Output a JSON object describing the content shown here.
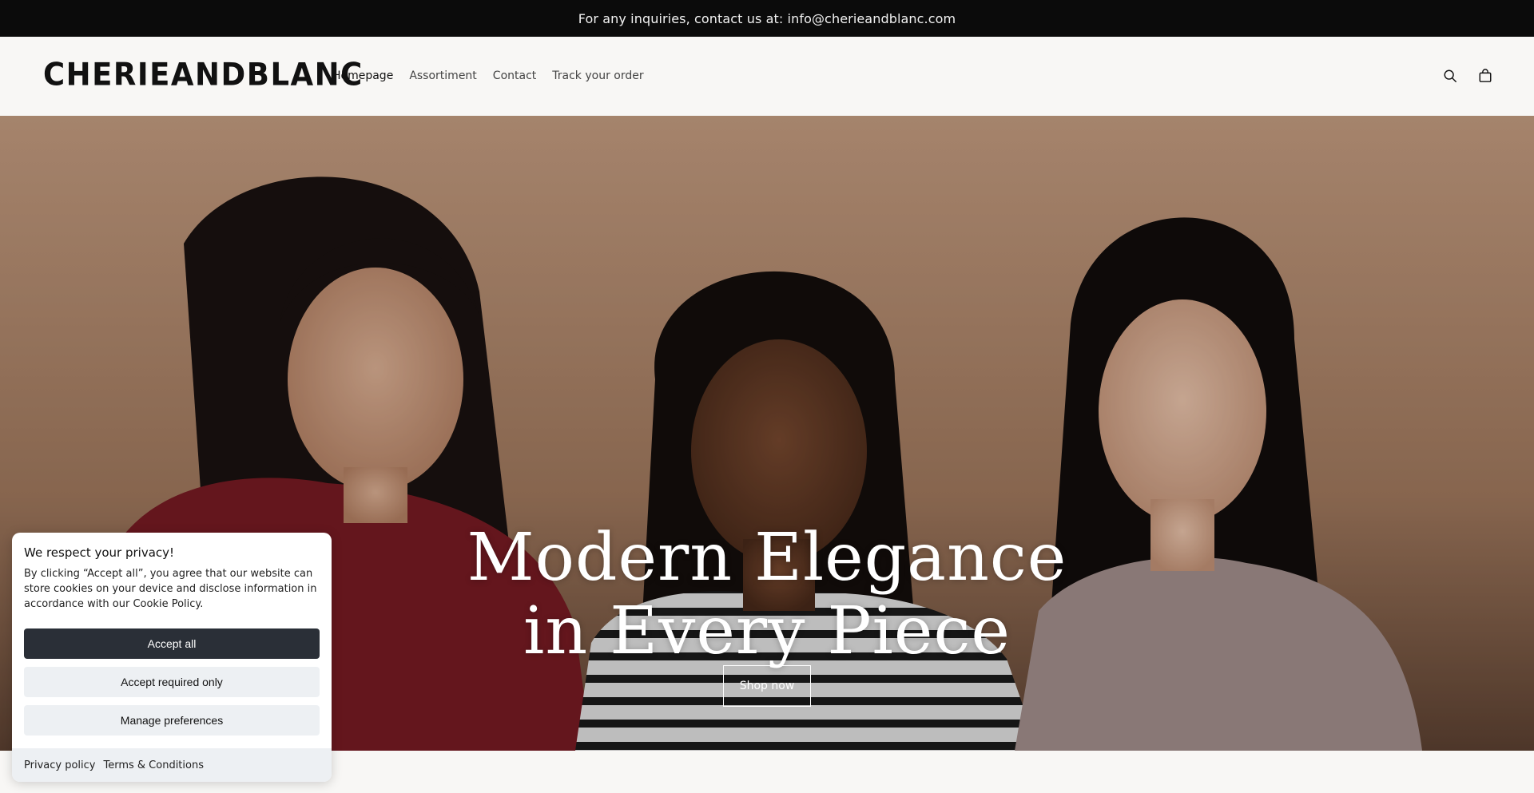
{
  "announcement": {
    "text": "For any inquiries, contact us at: info@cherieandblanc.com"
  },
  "header": {
    "logo": "CHERIEANDBLANC",
    "nav": [
      {
        "label": "Homepage",
        "active": true
      },
      {
        "label": "Assortiment",
        "active": false
      },
      {
        "label": "Contact",
        "active": false
      },
      {
        "label": "Track your order",
        "active": false
      }
    ],
    "icons": [
      "search-icon",
      "bag-icon"
    ]
  },
  "hero": {
    "title_line1": "Modern Elegance",
    "title_line2": "in Every Piece",
    "cta_label": "Shop now"
  },
  "cookie_banner": {
    "title": "We respect your privacy!",
    "body": "By clicking “Accept all”, you agree that our website can store cookies on your device and disclose information in accordance with our Cookie Policy.",
    "accept_all": "Accept all",
    "accept_required": "Accept required only",
    "manage": "Manage preferences",
    "links": [
      "Privacy policy",
      "Terms & Conditions"
    ]
  },
  "colors": {
    "announcement_bg": "#0b0b0b",
    "page_bg": "#f8f7f5",
    "primary_button": "#2a2f37",
    "secondary_button": "#edf0f3"
  }
}
